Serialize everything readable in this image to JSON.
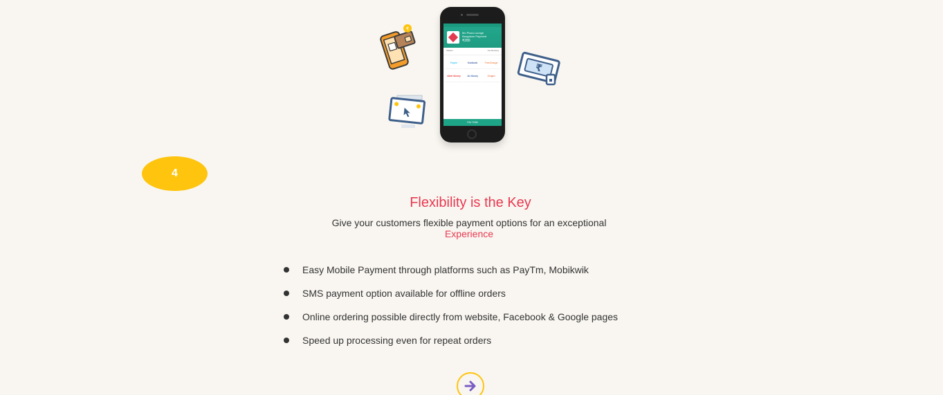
{
  "illustration": {
    "phone_header_title": "Mo Plaza Lounge",
    "phone_header_sub": "Bangalore Payment",
    "phone_amount": "₹280",
    "phone_tab_left": "Wallets",
    "phone_tab_right": "Net Banking",
    "wallets": [
      "Paytm",
      "Mobikwik",
      "FreeCharge",
      "Airtel Money",
      "Jio Money",
      "Oxigen"
    ],
    "pay_bar": "PAY ₹280"
  },
  "step": {
    "number": "4"
  },
  "section": {
    "title": "Flexibility is the Key",
    "subtitle_part1": "Give your customers flexible payment options for an exceptional",
    "subtitle_accent": "Experience"
  },
  "features": [
    "Easy Mobile Payment through platforms such as PayTm, Mobikwik",
    "SMS payment option available for offline orders",
    "Online ordering possible directly from website, Facebook & Google pages",
    "Speed up processing even for repeat orders"
  ],
  "colors": {
    "background": "#f9f6f1",
    "accent_red": "#e8384f",
    "accent_yellow": "#fec40e",
    "arrow_purple": "#7b5cc4",
    "teal": "#1ea486"
  },
  "icons": {
    "next": "arrow-right-icon",
    "mobile_payment": "mobile-payment-icon",
    "ticket": "rupee-ticket-icon",
    "desktop": "desktop-order-icon"
  }
}
